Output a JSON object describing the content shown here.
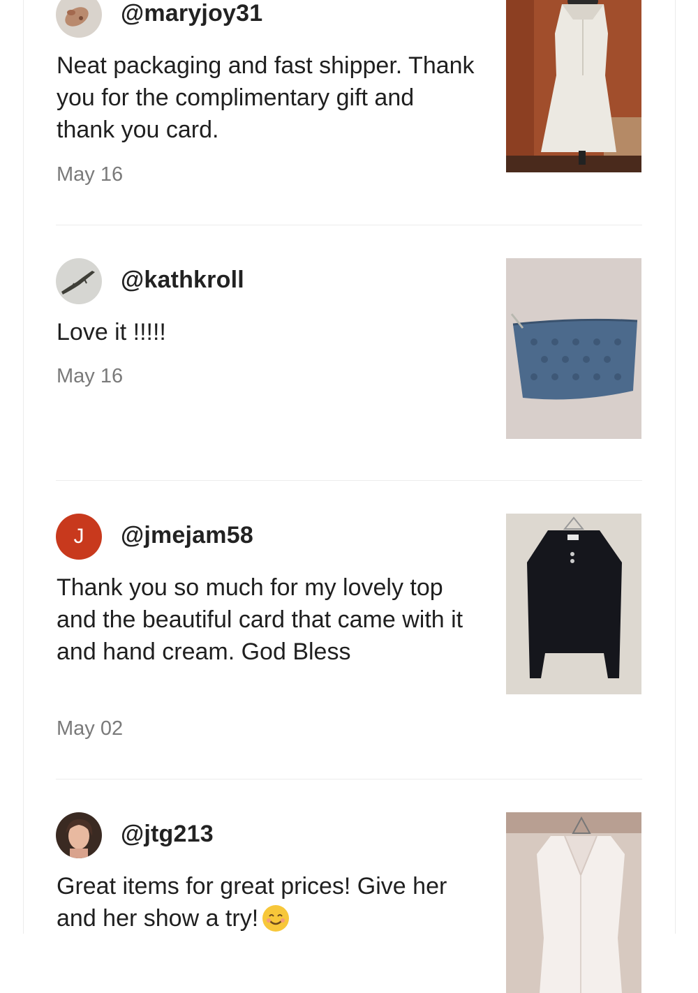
{
  "reviews": [
    {
      "username": "@maryjoy31",
      "text": "Neat packaging and fast shipper. Thank you for the complimentary gift and thank you card.",
      "date": "May 16",
      "avatar_icon": "hand-photo-avatar",
      "photo_icon": "white-dress-photo"
    },
    {
      "username": "@kathkroll",
      "text": "Love it !!!!!",
      "date": "May 16",
      "avatar_icon": "lizard-photo-avatar",
      "photo_icon": "blue-pouch-photo"
    },
    {
      "username": "@jmejam58",
      "avatar_letter": "J",
      "text": "Thank you so much for my lovely top and the beautiful card that came with it and hand cream. God Bless",
      "date": "May 02",
      "photo_icon": "black-top-photo"
    },
    {
      "username": "@jtg213",
      "text": "Great items for great prices! Give her and her show a try!",
      "emoji": "smiling-face-icon",
      "avatar_icon": "woman-photo-avatar",
      "photo_icon": "white-blouse-photo"
    }
  ],
  "colors": {
    "letter_avatar": "#c8391d",
    "date_text": "#7a7a7a",
    "divider": "#ececec"
  }
}
